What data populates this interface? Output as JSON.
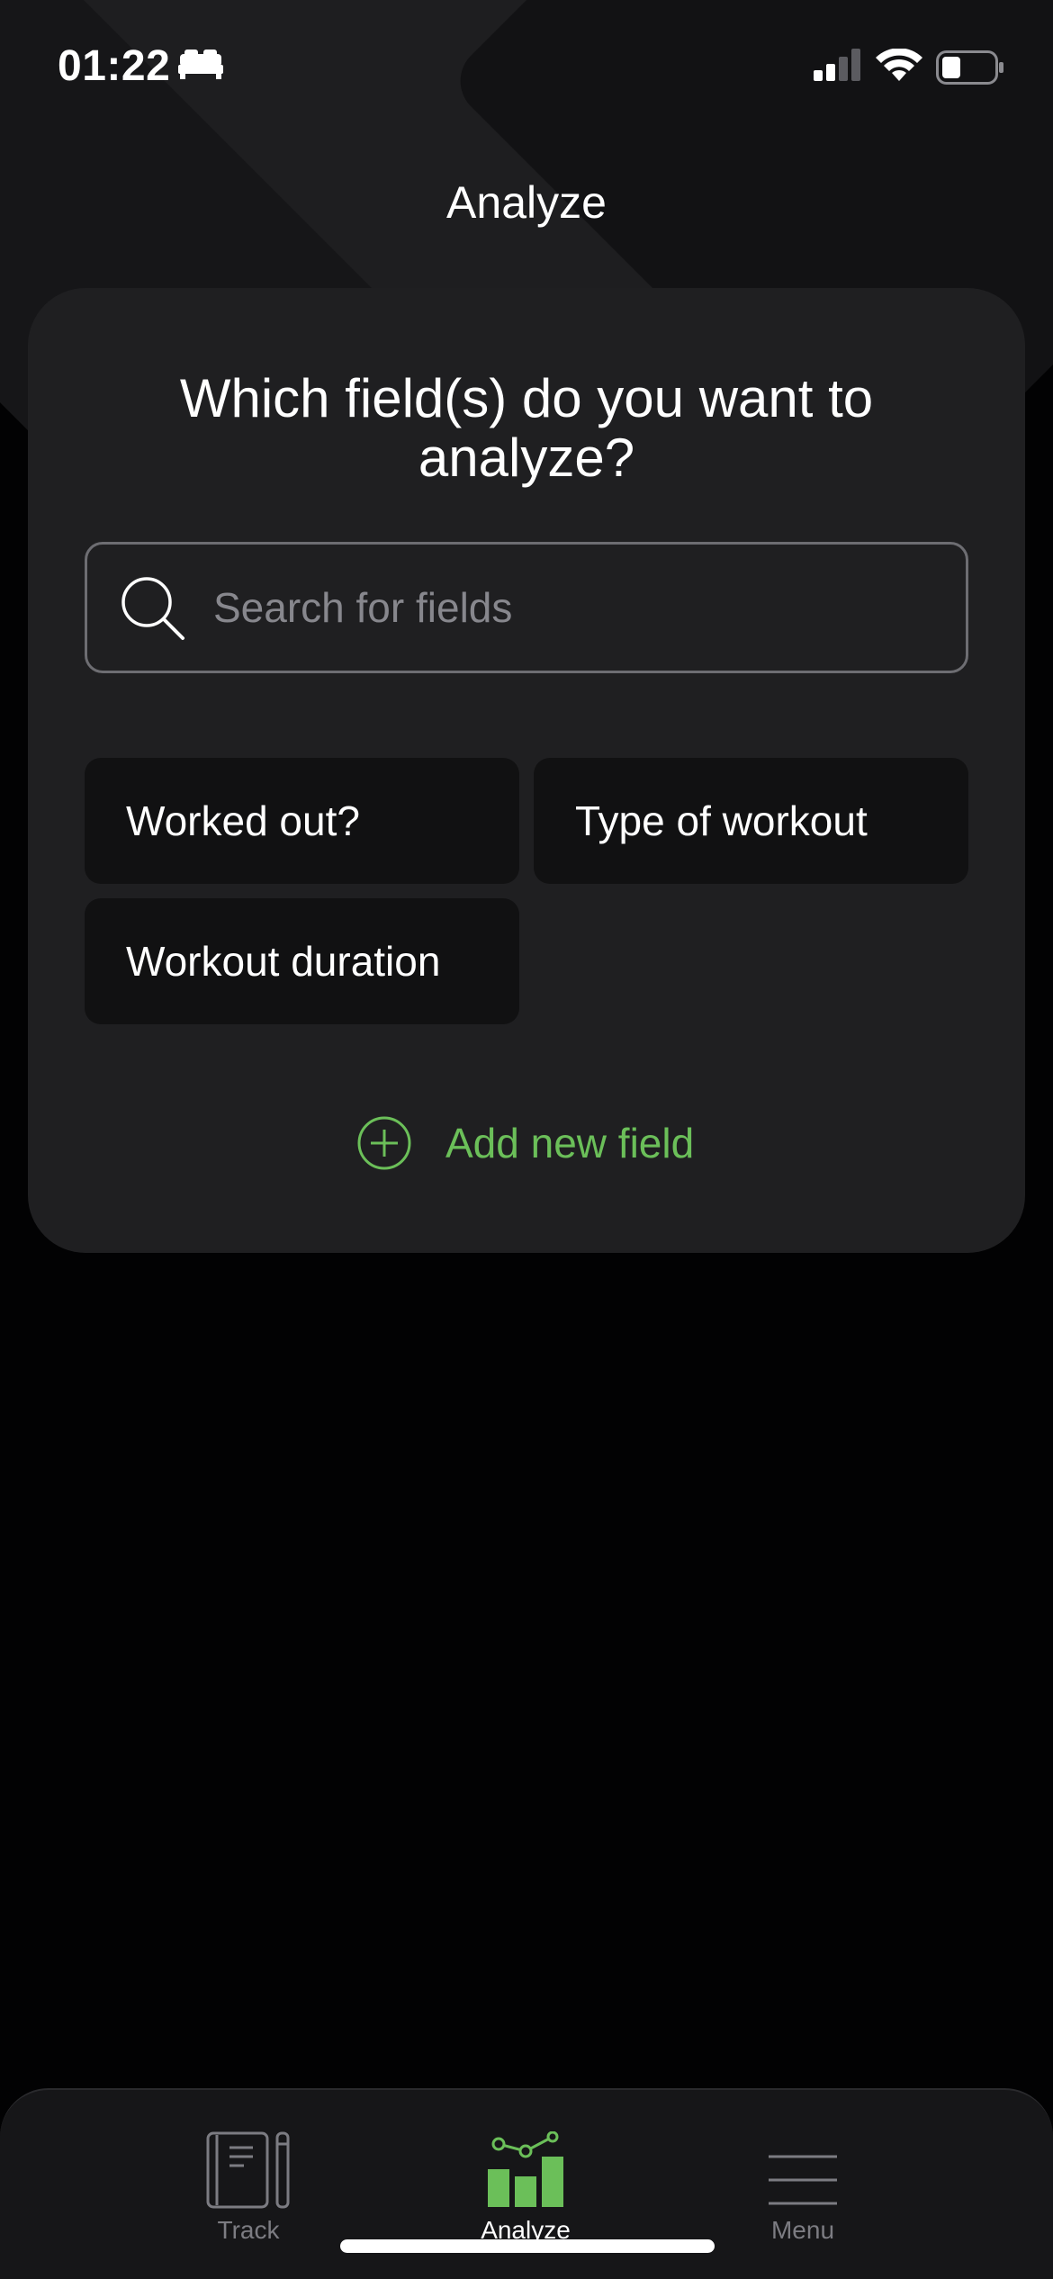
{
  "status_bar": {
    "time": "01:22",
    "icons": [
      "bed-icon",
      "signal-icon",
      "wifi-icon",
      "battery-icon"
    ]
  },
  "header": {
    "title": "Analyze"
  },
  "card": {
    "heading": "Which field(s) do you want to analyze?",
    "search": {
      "placeholder": "Search for fields",
      "value": ""
    },
    "fields": [
      "Worked out?",
      "Type of workout",
      "Workout duration"
    ],
    "add_field_label": "Add new field"
  },
  "tab_bar": {
    "tabs": [
      {
        "label": "Track",
        "icon": "notebook-icon",
        "active": false
      },
      {
        "label": "Analyze",
        "icon": "chart-icon",
        "active": true
      },
      {
        "label": "Menu",
        "icon": "menu-icon",
        "active": false
      }
    ]
  },
  "colors": {
    "accent": "#6bbf59",
    "card_background": "#1f1f21",
    "chip_background": "#111112",
    "screen_background": "#020203",
    "inactive_tab": "#7c7c82"
  }
}
